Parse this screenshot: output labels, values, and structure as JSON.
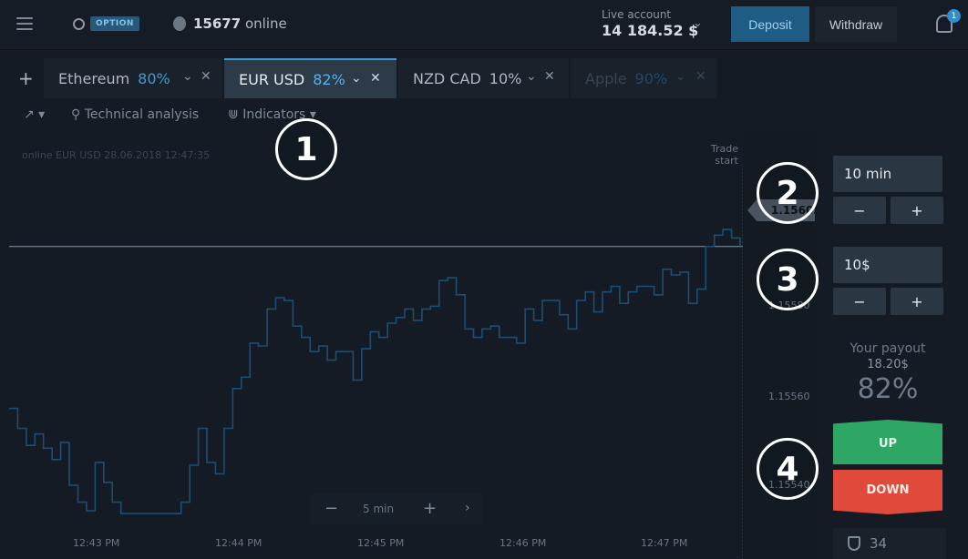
{
  "header": {
    "logo_text": "OPTION",
    "online_count": "15677",
    "online_label": "online",
    "account_label": "Live account",
    "account_balance": "14 184.52 $",
    "deposit_label": "Deposit",
    "withdraw_label": "Withdraw",
    "notification_count": "1"
  },
  "tabs": [
    {
      "name": "Ethereum",
      "payout": "80%"
    },
    {
      "name": "EUR USD",
      "payout": "82%"
    },
    {
      "name": "NZD CAD",
      "payout": "10%"
    },
    {
      "name": "Apple",
      "payout": "90%"
    }
  ],
  "toolbar": {
    "technical_analysis": "Technical analysis",
    "indicators": "Indicators"
  },
  "chart": {
    "caption": "online EUR USD  28.06.2018 12:47:35",
    "trade_start": [
      "Trade",
      "start"
    ],
    "current_price": "1.15602",
    "zoom_label": "5 min"
  },
  "chart_data": {
    "type": "line",
    "series": [
      {
        "values": [
          1.15545,
          1.15538,
          1.15532,
          1.15536,
          1.15531,
          1.15527,
          1.15533,
          1.15518,
          1.15512,
          1.15509,
          1.15526,
          1.15519,
          1.15512,
          1.15508,
          1.15508,
          1.15508,
          1.15508,
          1.15508,
          1.15508,
          1.15508,
          1.15512,
          1.15525,
          1.15538,
          1.15526,
          1.15522,
          1.15538,
          1.15552,
          1.15556,
          1.15568,
          1.15567,
          1.1558,
          1.15584,
          1.15583,
          1.15574,
          1.1557,
          1.15565,
          1.15567,
          1.15562,
          1.15565,
          1.15565,
          1.15555,
          1.15566,
          1.15572,
          1.1557,
          1.15575,
          1.15577,
          1.1558,
          1.15576,
          1.1558,
          1.15581,
          1.1559,
          1.15591,
          1.15585,
          1.15573,
          1.1557,
          1.15573,
          1.15574,
          1.1557,
          1.1557,
          1.15568,
          1.1558,
          1.15576,
          1.15583,
          1.15583,
          1.15578,
          1.15573,
          1.15583,
          1.15586,
          1.15579,
          1.15586,
          1.15588,
          1.15582,
          1.15586,
          1.15588,
          1.15588,
          1.15585,
          1.15594,
          1.15592,
          1.15593,
          1.15582,
          1.15587,
          1.15602,
          1.15606,
          1.15608,
          1.15605,
          1.15602
        ]
      }
    ],
    "x_ticks": [
      "12:43 PM",
      "12:44 PM",
      "12:45 PM",
      "12:46 PM",
      "12:47 PM"
    ],
    "y_ticks": [
      {
        "value": 1.15602,
        "label": "1.15602"
      },
      {
        "value": 1.1558,
        "label": "1.15580"
      },
      {
        "value": 1.1556,
        "label": "1.15560"
      },
      {
        "value": 1.1554,
        "label": "1.15540"
      }
    ],
    "ylim": [
      1.15492,
      1.15642
    ],
    "grid": false
  },
  "markers": [
    "1",
    "2",
    "3",
    "4"
  ],
  "panel": {
    "duration": "10 min",
    "amount": "10$",
    "minus": "−",
    "plus": "+",
    "payout_label": "Your payout",
    "payout_amount": "18.20$",
    "payout_percent": "82%",
    "up_label": "UP",
    "down_label": "DOWN",
    "trades_count": "34"
  },
  "colors": {
    "accent": "#3c9bd4",
    "line": "#1d4e72",
    "up": "#2ea664",
    "down": "#e04a3b"
  }
}
